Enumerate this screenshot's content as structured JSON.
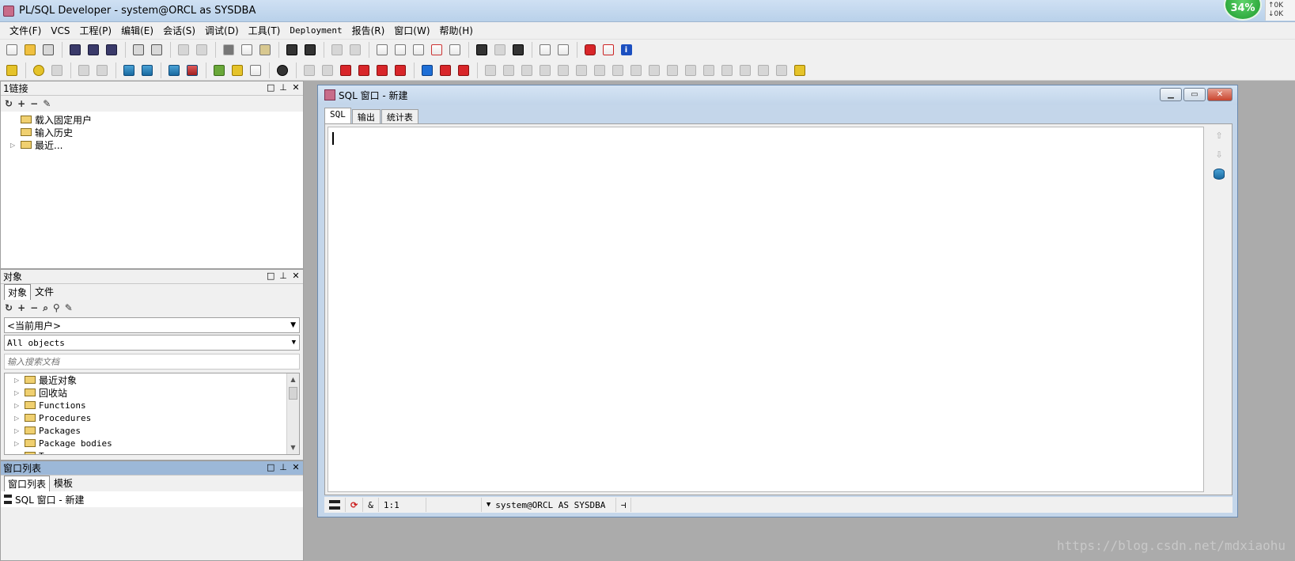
{
  "window": {
    "title": "PL/SQL Developer - system@ORCL as SYSDBA",
    "perf_percent": "34%",
    "net_up": "0K",
    "net_down": "0K"
  },
  "menu": [
    {
      "label": "文件(F)",
      "mono": false
    },
    {
      "label": "VCS",
      "mono": false
    },
    {
      "label": "工程(P)",
      "mono": false
    },
    {
      "label": "编辑(E)",
      "mono": false
    },
    {
      "label": "会话(S)",
      "mono": false
    },
    {
      "label": "调试(D)",
      "mono": false
    },
    {
      "label": "工具(T)",
      "mono": false
    },
    {
      "label": "Deployment",
      "mono": true
    },
    {
      "label": "报告(R)",
      "mono": false
    },
    {
      "label": "窗口(W)",
      "mono": false
    },
    {
      "label": "帮助(H)",
      "mono": false
    }
  ],
  "connections_panel": {
    "title": "1链接",
    "items": [
      "载入固定用户",
      "输入历史",
      "最近..."
    ]
  },
  "objects_panel": {
    "title": "对象",
    "tabs": [
      "对象",
      "文件"
    ],
    "user_combo": "<当前用户>",
    "filter_combo": "All objects",
    "search_placeholder": "输入搜索文档",
    "items": [
      {
        "label": "最近对象",
        "mono": false
      },
      {
        "label": "回收站",
        "mono": false
      },
      {
        "label": "Functions",
        "mono": true
      },
      {
        "label": "Procedures",
        "mono": true
      },
      {
        "label": "Packages",
        "mono": true
      },
      {
        "label": "Package bodies",
        "mono": true
      },
      {
        "label": "Types",
        "mono": true
      }
    ]
  },
  "windowlist_panel": {
    "title": "窗口列表",
    "tabs": [
      "窗口列表",
      "模板"
    ],
    "items": [
      "SQL 窗口 - 新建"
    ]
  },
  "sql_window": {
    "title": "SQL 窗口 - 新建",
    "tabs": [
      "SQL",
      "输出",
      "统计表"
    ],
    "status": {
      "amp": "&",
      "position": "1:1",
      "connection": "system@ORCL AS SYSDBA"
    }
  },
  "watermark": "https://blog.csdn.net/mdxiaohu"
}
